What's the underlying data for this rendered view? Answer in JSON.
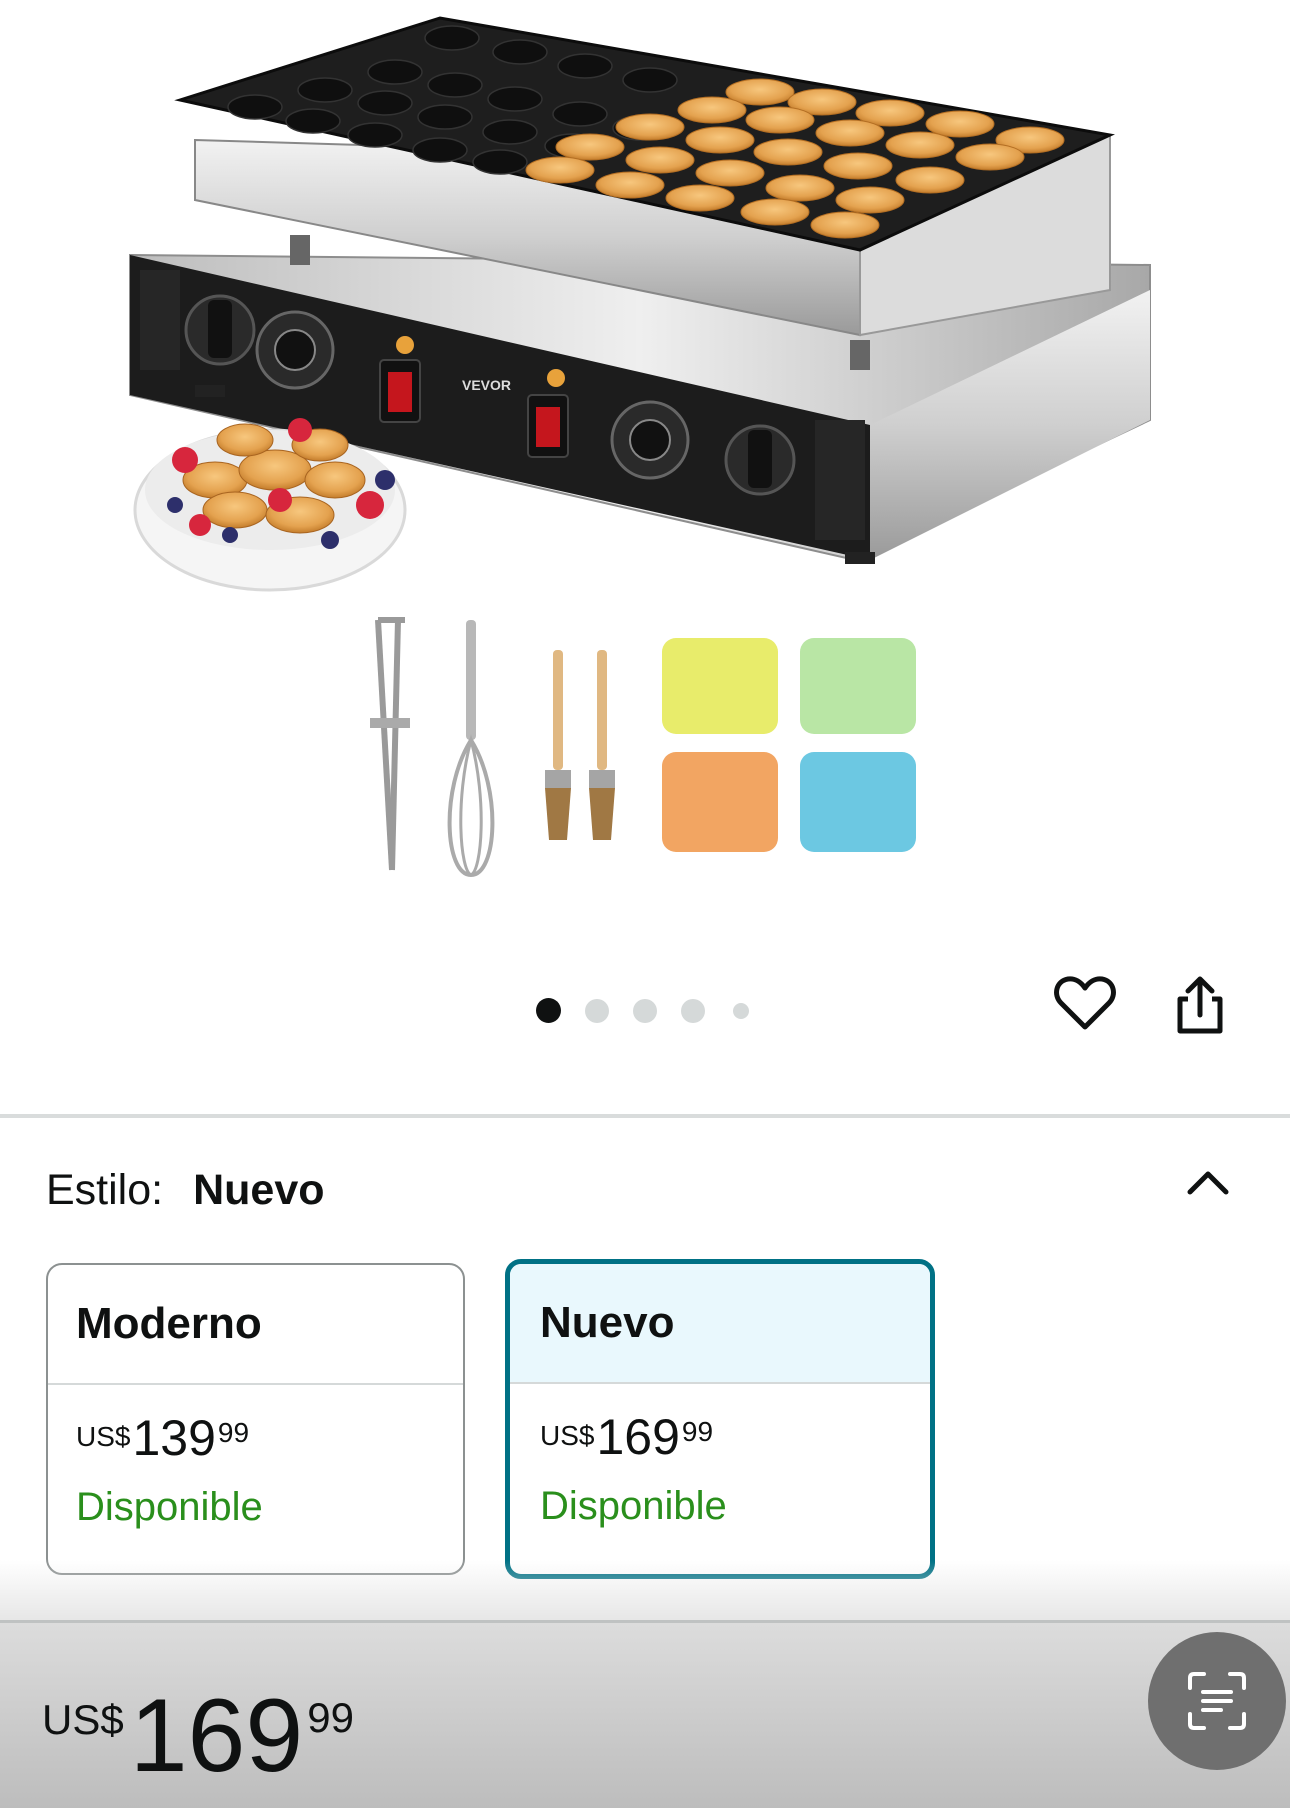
{
  "gallery": {
    "image_name": "mini-pancake-maker-product-photo",
    "brand_on_device": "VEVOR",
    "carousel": {
      "total_dots": 5,
      "active_index": 0
    },
    "actions": {
      "wishlist_icon": "heart-icon",
      "share_icon": "share-icon"
    }
  },
  "style_selector": {
    "label": "Estilo:",
    "selected_value": "Nuevo",
    "collapse_icon": "chevron-up-icon",
    "options": [
      {
        "name": "Moderno",
        "currency": "US$",
        "price_whole": "139",
        "price_fraction": "99",
        "availability": "Disponible",
        "selected": false
      },
      {
        "name": "Nuevo",
        "currency": "US$",
        "price_whole": "169",
        "price_fraction": "99",
        "availability": "Disponible",
        "selected": true
      }
    ]
  },
  "bottom_bar": {
    "currency": "US$",
    "price_whole": "169",
    "price_fraction": "99",
    "scan_icon": "scan-text-icon"
  },
  "colors": {
    "selected_border": "#007185",
    "selected_header_bg": "#e9f8fd",
    "availability_green": "#2a8f1c"
  }
}
